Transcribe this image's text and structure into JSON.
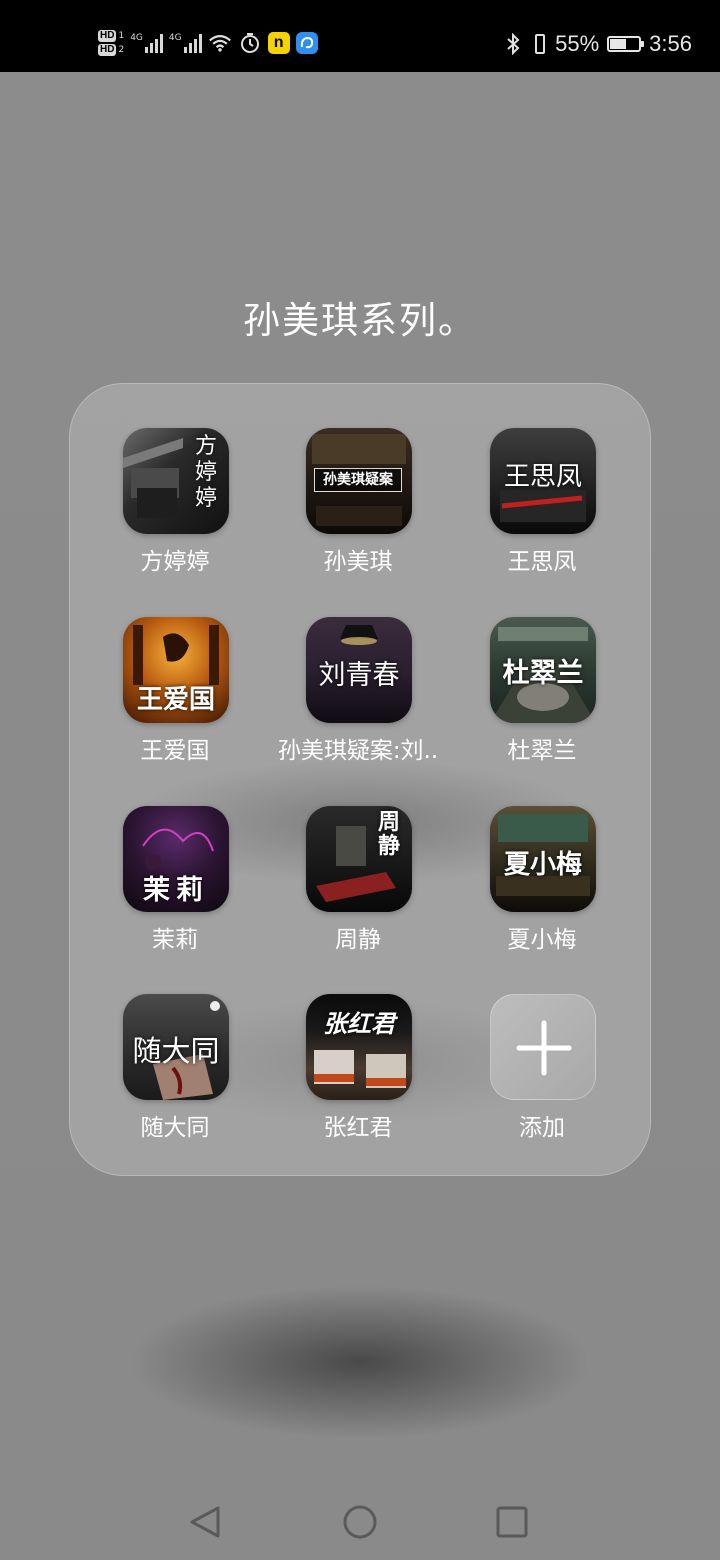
{
  "status_bar": {
    "sim1": "HD",
    "sim1_num": "1",
    "sim2": "HD",
    "sim2_num": "2",
    "net1": "4G",
    "net2": "4G",
    "wifi_speed": "4",
    "battery_percent": "55%",
    "battery_level": 0.55,
    "time": "3:56",
    "icons": [
      "hd-icon",
      "signal-icon",
      "wifi-icon",
      "alarm-icon",
      "app-notification-icon",
      "bluetooth-icon",
      "vibrate-icon",
      "battery-icon"
    ]
  },
  "folder": {
    "title": "孙美琪系列。",
    "apps": [
      {
        "label": "方婷婷",
        "icon_text": "方婷婷",
        "icon": "fangtingting-app-icon"
      },
      {
        "label": "孙美琪",
        "icon_text": "孙美琪疑案",
        "icon": "sunmeiqi-app-icon"
      },
      {
        "label": "王思凤",
        "icon_text": "王思凤",
        "icon": "wangsifeng-app-icon"
      },
      {
        "label": "王爱国",
        "icon_text": "王爱国",
        "icon": "wangaiguo-app-icon"
      },
      {
        "label": "孙美琪疑案:刘..",
        "icon_text": "刘青春",
        "icon": "liuqingchun-app-icon"
      },
      {
        "label": "杜翠兰",
        "icon_text": "杜翠兰",
        "icon": "ducuilan-app-icon"
      },
      {
        "label": "茉莉",
        "icon_text": "茉莉",
        "icon": "moli-app-icon"
      },
      {
        "label": "周静",
        "icon_text": "周静",
        "icon": "zhoujing-app-icon"
      },
      {
        "label": "夏小梅",
        "icon_text": "夏小梅",
        "icon": "xiaxiaomei-app-icon"
      },
      {
        "label": "随大同",
        "icon_text": "随大同",
        "icon": "suidatong-app-icon"
      },
      {
        "label": "张红君",
        "icon_text": "张红君",
        "icon": "zhanghongjun-app-icon"
      },
      {
        "label": "添加",
        "icon_text": "+",
        "icon": "add-icon"
      }
    ]
  },
  "nav_bar": {
    "buttons": [
      "back-icon",
      "home-icon",
      "recents-icon"
    ]
  }
}
